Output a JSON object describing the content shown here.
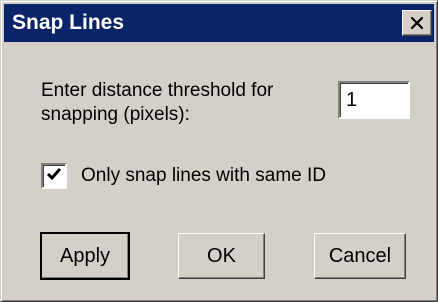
{
  "window": {
    "title": "Snap Lines",
    "close_icon": "close-icon"
  },
  "form": {
    "threshold_label": "Enter distance threshold for snapping (pixels):",
    "threshold_value": "1",
    "checkbox_label": "Only snap lines with same ID",
    "checkbox_checked": true
  },
  "buttons": {
    "apply": "Apply",
    "ok": "OK",
    "cancel": "Cancel"
  },
  "colors": {
    "titlebar": "#0a246a",
    "face": "#d4d0c8"
  }
}
